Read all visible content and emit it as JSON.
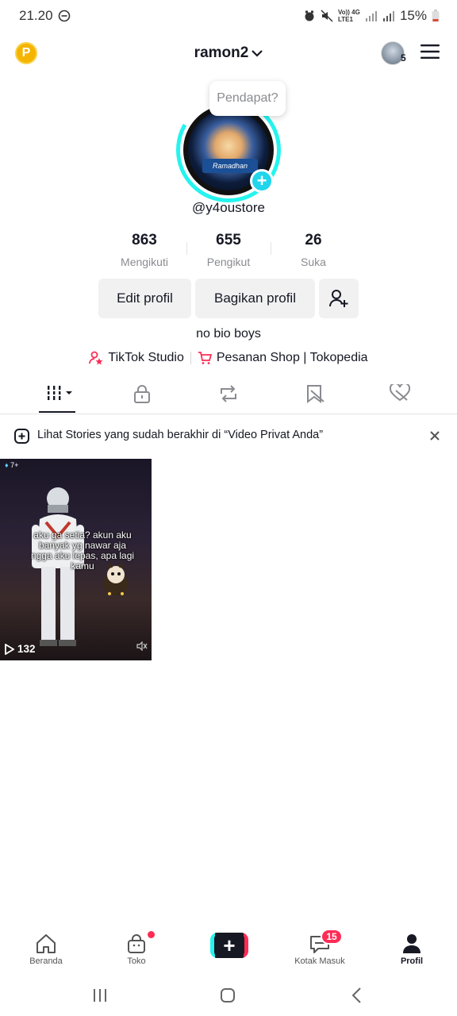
{
  "status_bar": {
    "time": "21.20",
    "network": "Vo)) 4G LTE1",
    "battery": "15%"
  },
  "header": {
    "username": "ramon2",
    "coin_label": "P",
    "notif_count": "5"
  },
  "profile": {
    "bubble": "Pendapat?",
    "handle": "@y4oustore",
    "pic_banner": "Ramadhan"
  },
  "stats": [
    {
      "value": "863",
      "label": "Mengikuti"
    },
    {
      "value": "655",
      "label": "Pengikut"
    },
    {
      "value": "26",
      "label": "Suka"
    }
  ],
  "buttons": {
    "edit": "Edit profil",
    "share": "Bagikan profil"
  },
  "bio": "no bio boys",
  "links": {
    "studio": "TikTok Studio",
    "shop": "Pesanan Shop | Tokopedia"
  },
  "notice": {
    "text": "Lihat Stories yang sudah berakhir di “Video Privat Anda”"
  },
  "video": {
    "caption": "aku ga setia? akun aku banyak yg nawar aja ngga aku lepas, apa lagi kamu",
    "views": "132",
    "top_badge": "7+"
  },
  "bottom_nav": {
    "home": "Beranda",
    "shop": "Toko",
    "inbox": "Kotak Masuk",
    "inbox_badge": "15",
    "profile": "Profil"
  },
  "colors": {
    "accent_cyan": "#25f4ee",
    "accent_red": "#fe2c55",
    "text": "#161823",
    "muted": "#8a8b91"
  }
}
